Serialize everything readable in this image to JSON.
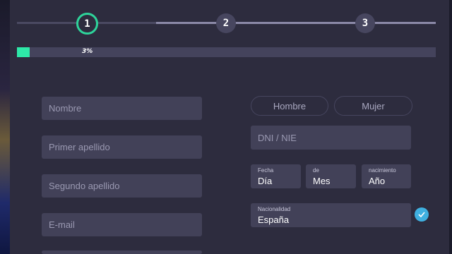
{
  "stepper": {
    "steps": [
      "1",
      "2",
      "3"
    ],
    "active_step": 1
  },
  "progress": {
    "label": "3%",
    "value_percent": 3
  },
  "form": {
    "name_placeholder": "Nombre",
    "first_surname_placeholder": "Primer apellido",
    "second_surname_placeholder": "Segundo apellido",
    "email_placeholder": "E-mail",
    "gender": {
      "male": "Hombre",
      "female": "Mujer"
    },
    "dni_placeholder": "DNI / NIE",
    "birth": {
      "day_caption": "Fecha",
      "day_value": "Día",
      "month_caption": "de",
      "month_value": "Mes",
      "year_caption": "nacimiento",
      "year_value": "Año"
    },
    "nationality": {
      "caption": "Nacionalidad",
      "value": "España"
    }
  },
  "colors": {
    "accent_green": "#2ed39a",
    "progress_fill": "#2ee8a8",
    "check_blue": "#3fb0e0",
    "field_bg": "#424158"
  }
}
